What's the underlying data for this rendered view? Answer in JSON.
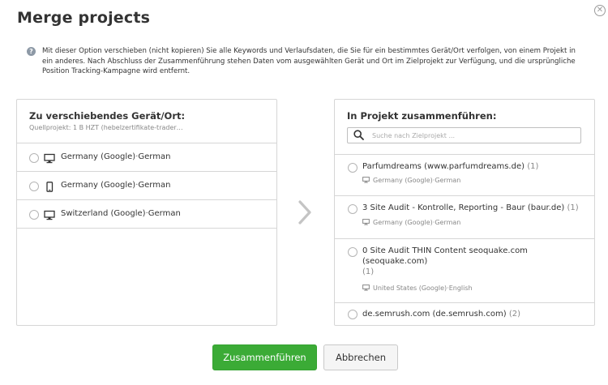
{
  "dialog": {
    "title": "Merge projects",
    "close_label": "✕"
  },
  "info": {
    "icon_name": "question-icon",
    "text": "Mit dieser Option verschieben (nicht kopieren) Sie alle Keywords und Verlaufsdaten, die Sie für ein bestimmtes Gerät/Ort verfolgen, von einem Projekt in ein anderes. Nach Abschluss der Zusammenführung stehen Daten vom ausgewählten Gerät und Ort im Zielprojekt zur Verfügung, und die ursprüngliche Position Tracking-Kampagne wird entfernt."
  },
  "source_panel": {
    "title": "Zu verschiebendes Gerät/Ort:",
    "source_label": "Quellprojekt:",
    "source_value": "1 B HZT (hebelzertifikate-trader…",
    "locations": [
      {
        "device": "desktop-icon",
        "country": "Germany (Google)",
        "sep": "·",
        "language": "German"
      },
      {
        "device": "mobile-icon",
        "country": "Germany (Google)",
        "sep": "·",
        "language": "German"
      },
      {
        "device": "desktop-icon",
        "country": "Switzerland (Google)",
        "sep": "·",
        "language": "German"
      }
    ]
  },
  "target_panel": {
    "title": "In Projekt zusammenführen:",
    "search_placeholder": "Suche nach Zielprojekt ...",
    "search_value": "",
    "projects": [
      {
        "name": "Parfumdreams (www.parfumdreams.de)",
        "count": "(1)",
        "location": "Germany (Google)",
        "sep": "·",
        "language": "German"
      },
      {
        "name": "3 Site Audit - Kontrolle, Reporting - Baur (baur.de)",
        "count": "(1)",
        "location": "Germany (Google)",
        "sep": "·",
        "language": "German"
      },
      {
        "name": "0 Site Audit THIN Content seoquake.com (seoquake.com)",
        "count": "(1)",
        "location": "United States (Google)",
        "sep": "·",
        "language": "English"
      },
      {
        "name": "de.semrush.com (de.semrush.com)",
        "count": "(2)"
      }
    ]
  },
  "actions": {
    "merge_label": "Zusammenführen",
    "cancel_label": "Abbrechen"
  },
  "colors": {
    "primary": "#3bab36",
    "border": "#d6d6d6",
    "muted_text": "#888888"
  }
}
